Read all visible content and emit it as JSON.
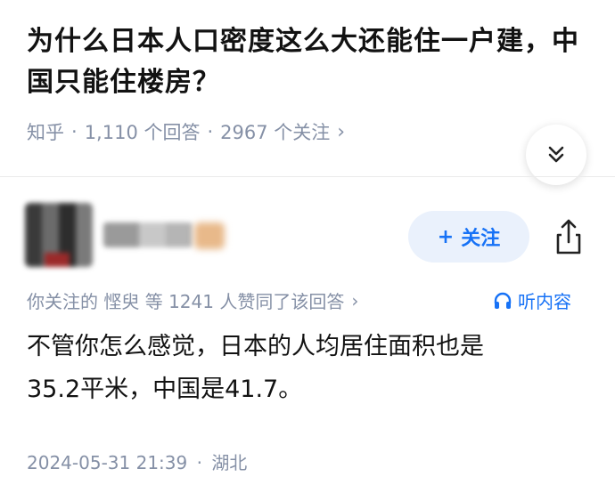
{
  "question": {
    "title": "为什么日本人口密度这么大还能住一户建，中国只能住楼房？",
    "source": "知乎",
    "answers_count": "1,110 个回答",
    "followers_count": "2967 个关注",
    "meta_separator": "·",
    "chevron": "›"
  },
  "author": {
    "follow_label": "关注",
    "follow_prefix": "+"
  },
  "social_proof": {
    "text": "你关注的 悭臾 等 1241 人赞同了该回答",
    "chevron": "›"
  },
  "listen_label": "听内容",
  "answer": {
    "line1": "不管你怎么感觉，日本的人均居住面积也是",
    "line2": "35.2平米，中国是41.7。",
    "datetime": "2024-05-31 21:39",
    "location": "湖北",
    "separator": "·"
  },
  "colors": {
    "accent": "#1772f6",
    "meta_gray": "#8590a6"
  },
  "icons": [
    "chevron-down-double-icon",
    "share-icon",
    "headphones-icon",
    "chevron-right-icon"
  ]
}
